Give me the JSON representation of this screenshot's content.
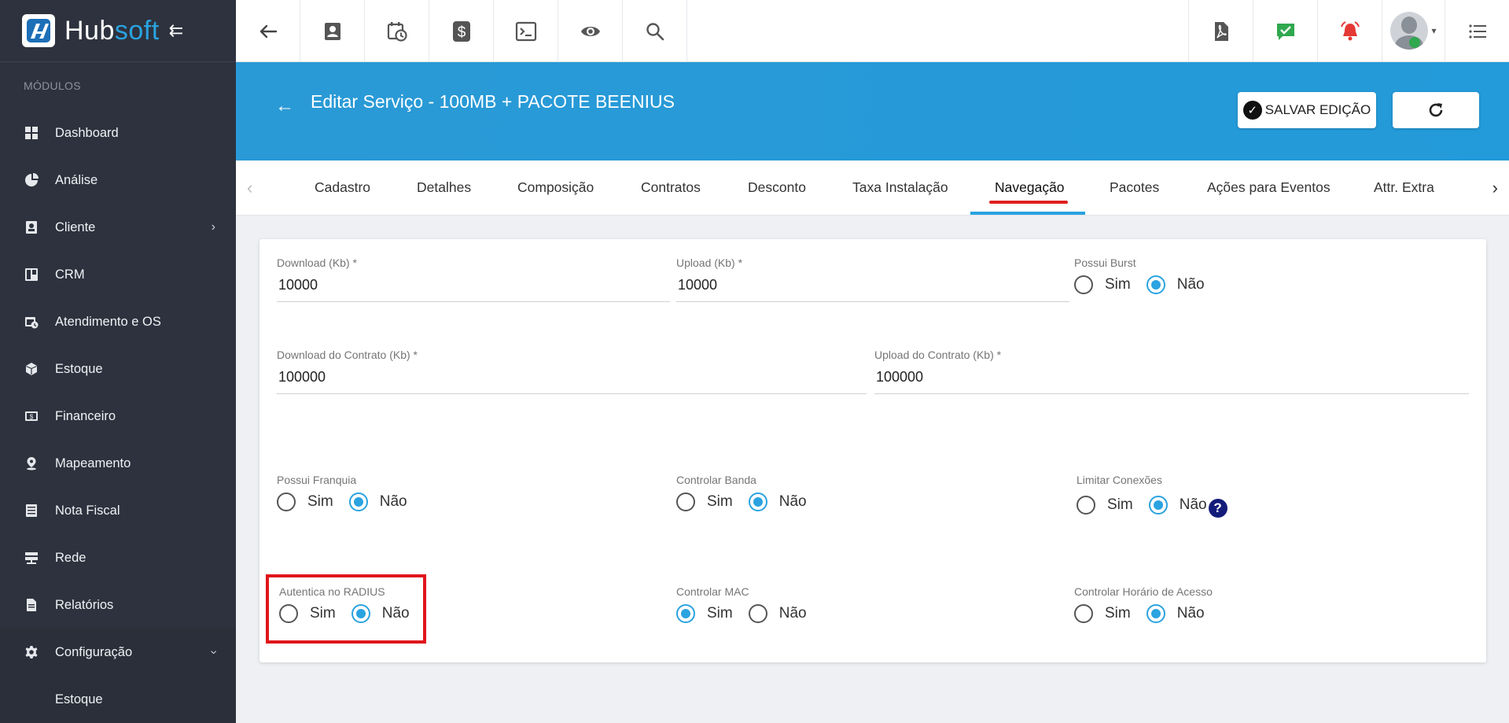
{
  "brand": {
    "hub": "Hub",
    "soft": "soft"
  },
  "sidebar": {
    "section_label": "MÓDULOS",
    "items": [
      {
        "label": "Dashboard",
        "icon": "dashboard-icon"
      },
      {
        "label": "Análise",
        "icon": "pie-chart-icon"
      },
      {
        "label": "Cliente",
        "icon": "contact-card-icon",
        "has_chevron": true
      },
      {
        "label": "CRM",
        "icon": "board-icon"
      },
      {
        "label": "Atendimento e OS",
        "icon": "calendar-clock-icon"
      },
      {
        "label": "Estoque",
        "icon": "box-icon"
      },
      {
        "label": "Financeiro",
        "icon": "money-icon"
      },
      {
        "label": "Mapeamento",
        "icon": "map-pin-icon"
      },
      {
        "label": "Nota Fiscal",
        "icon": "receipt-icon"
      },
      {
        "label": "Rede",
        "icon": "server-icon"
      },
      {
        "label": "Relatórios",
        "icon": "document-icon"
      },
      {
        "label": "Configuração",
        "icon": "gear-icon",
        "expanded": true
      }
    ],
    "sub_items": [
      {
        "label": "Estoque"
      }
    ],
    "chevron_right": "›",
    "chevron_down": "⌄"
  },
  "topbar": {
    "icons": [
      "back-arrow-icon",
      "contact-card-icon",
      "calendar-clock-icon",
      "dollar-icon",
      "terminal-icon",
      "eye-icon",
      "search-icon"
    ],
    "right_icons": [
      "pdf-icon",
      "checked-message-icon",
      "alarm-bell-icon"
    ],
    "avatar_status_color": "#2fa84f"
  },
  "header": {
    "title": "Editar Serviço - 100MB + PACOTE BEENIUS",
    "save_label": "SALVAR EDIÇÃO",
    "back_arrow": "←"
  },
  "tabs": {
    "items": [
      "Cadastro",
      "Detalhes",
      "Composição",
      "Contratos",
      "Desconto",
      "Taxa Instalação",
      "Navegação",
      "Pacotes",
      "Ações para Eventos",
      "Attr. Extra"
    ],
    "active": "Navegação",
    "left_arrow": "‹",
    "right_arrow": "›"
  },
  "form": {
    "download": {
      "label": "Download (Kb)",
      "req": "*",
      "value": "10000"
    },
    "upload": {
      "label": "Upload (Kb)",
      "req": "*",
      "value": "10000"
    },
    "possui_burst": {
      "label": "Possui Burst",
      "selected": "Não"
    },
    "download_contrato": {
      "label": "Download do Contrato (Kb)",
      "req": "*",
      "value": "100000"
    },
    "upload_contrato": {
      "label": "Upload do Contrato (Kb)",
      "req": "*",
      "value": "100000"
    },
    "possui_franquia": {
      "label": "Possui Franquia",
      "selected": "Não"
    },
    "controlar_banda": {
      "label": "Controlar Banda",
      "selected": "Não"
    },
    "limitar_conexoes": {
      "label": "Limitar Conexões",
      "selected": "Não",
      "help": "?"
    },
    "autentica_radius": {
      "label": "Autentica no RADIUS",
      "selected": "Não",
      "highlighted": true
    },
    "controlar_mac": {
      "label": "Controlar MAC",
      "selected": "Sim"
    },
    "controlar_horario": {
      "label": "Controlar Horário de Acesso",
      "selected": "Não"
    },
    "opt_sim": "Sim",
    "opt_nao": "Não"
  },
  "colors": {
    "accent": "#2aa3e0",
    "sidebar_bg": "#2d323e",
    "highlight": "#e0151b",
    "tab_marker": "#e02020"
  }
}
